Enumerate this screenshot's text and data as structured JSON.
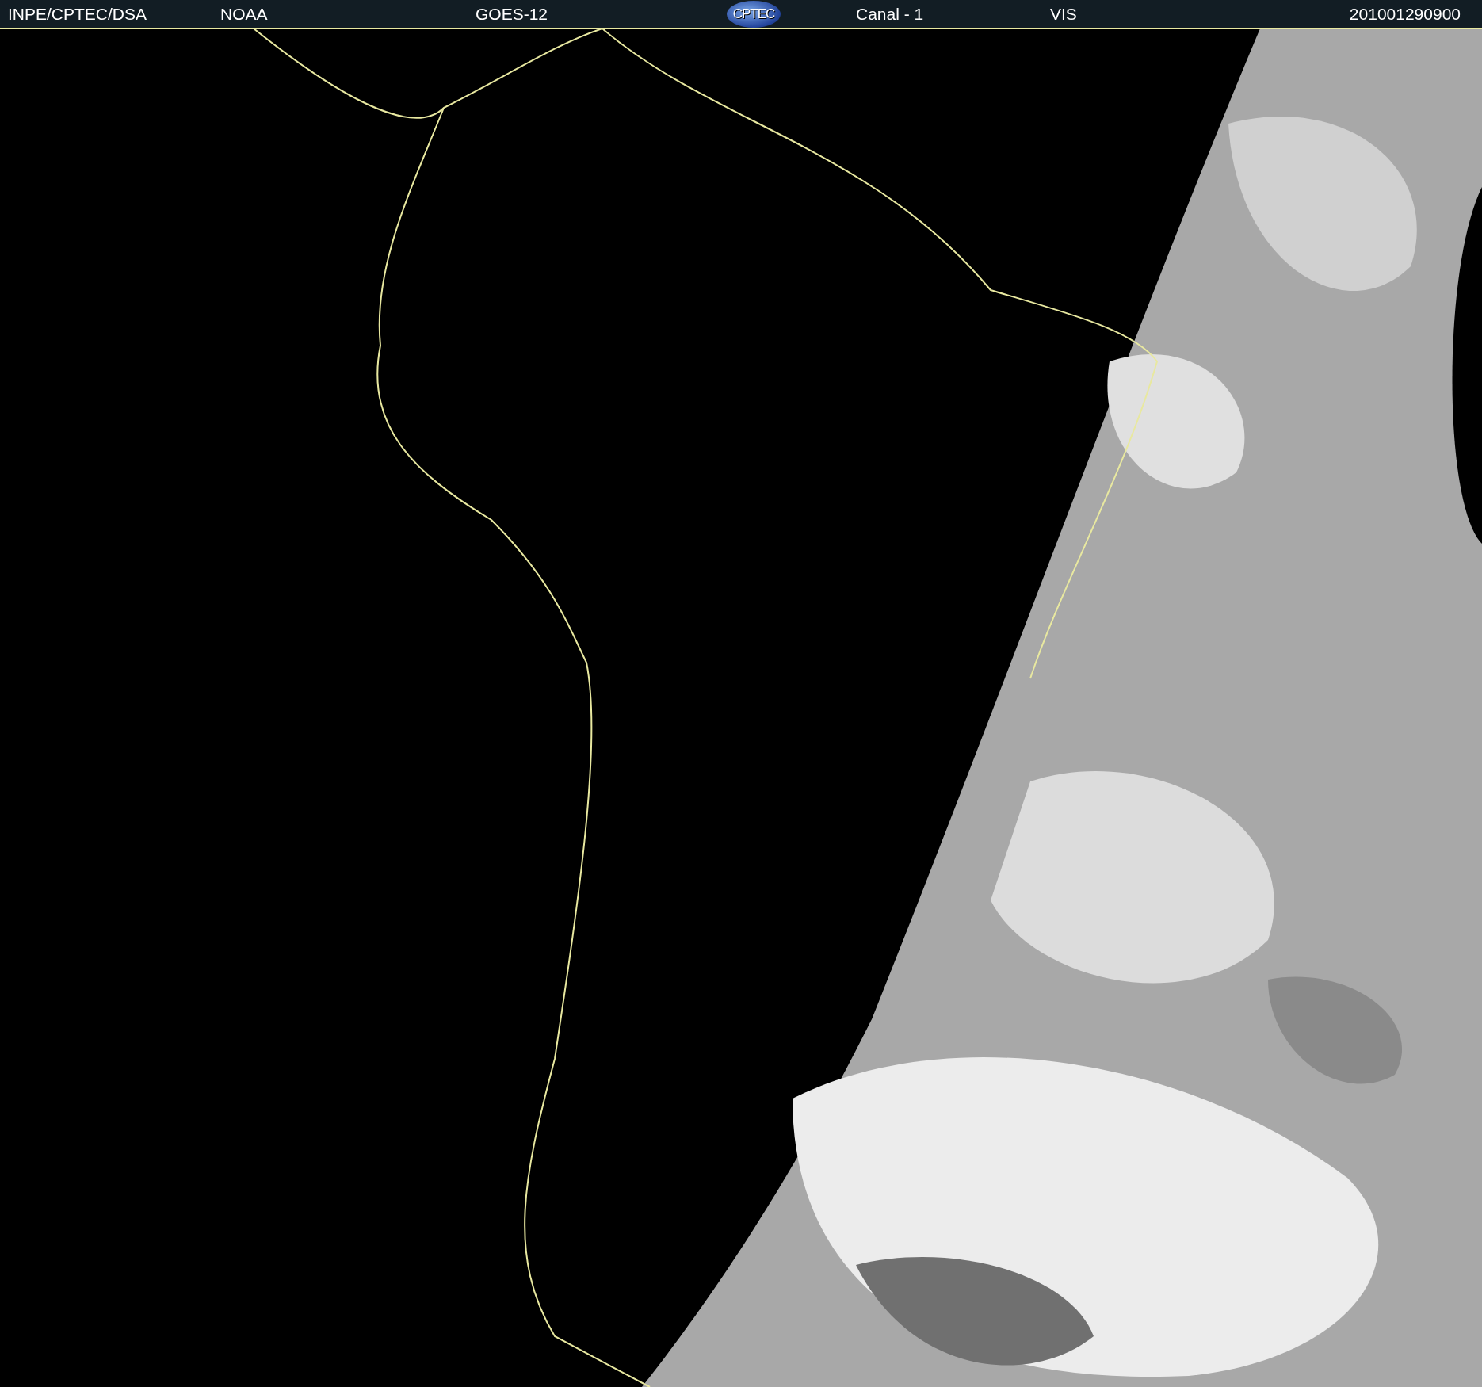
{
  "header": {
    "items": [
      {
        "kind": "text",
        "text": "INPE/CPTEC/DSA"
      },
      {
        "kind": "text",
        "text": "NOAA"
      },
      {
        "kind": "text",
        "text": "GOES-12"
      },
      {
        "kind": "logo",
        "text": "CPTEC"
      },
      {
        "kind": "text",
        "text": "Canal - 1"
      },
      {
        "kind": "text",
        "text": "VIS"
      },
      {
        "kind": "text",
        "text": "201001290900"
      }
    ]
  }
}
